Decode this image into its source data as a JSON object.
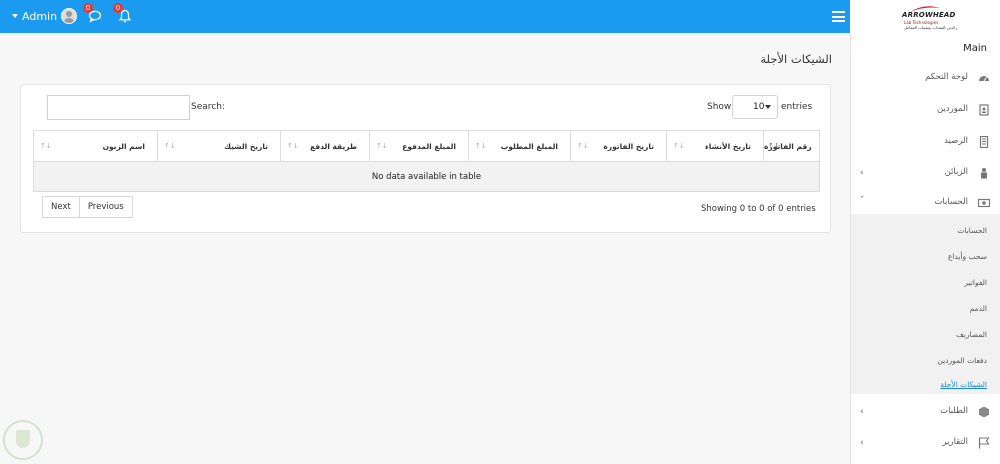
{
  "header": {
    "user_name": "Admin",
    "messages_count": "0",
    "notifications_count": "0",
    "logo_text": "ARROWHEAD",
    "logo_tagline": "Lab Technologies",
    "logo_tagline_ar": "رائدين المعدات وتقنيات المعامل"
  },
  "sidebar": {
    "main_label": "Main",
    "items": [
      {
        "label": "لوحة التحكم",
        "icon": "dashboard-icon"
      },
      {
        "label": "الموردين",
        "icon": "suppliers-icon"
      },
      {
        "label": "الرصيد",
        "icon": "balance-icon"
      },
      {
        "label": "الزبائن",
        "icon": "customers-icon"
      },
      {
        "label": "الحسابات",
        "icon": "accounts-icon"
      },
      {
        "label": "الطلبات",
        "icon": "orders-icon"
      },
      {
        "label": "التقارير",
        "icon": "reports-icon"
      }
    ],
    "submenu": [
      {
        "label": "الحسابات"
      },
      {
        "label": "سحب وأيداع"
      },
      {
        "label": "الفواتير"
      },
      {
        "label": "الذمم"
      },
      {
        "label": "المصاريف"
      },
      {
        "label": "دفعات الموردين"
      },
      {
        "label": "الشيكات الأجلة"
      }
    ]
  },
  "page": {
    "title": "الشيكات الأجلة"
  },
  "table_controls": {
    "show_label": "Show",
    "length_value": "10",
    "entries_label": "entries",
    "search_label": "Search:",
    "search_value": ""
  },
  "table": {
    "columns": [
      "رقم الفاتورة",
      "تاريخ الأنشاء",
      "تاريخ الفاتورة",
      "المبلغ المطلوب",
      "المبلغ المدفوع",
      "طريقة الدفع",
      "تاريخ الشيك",
      "اسم الزبون",
      ""
    ],
    "empty_message": "No data available in table"
  },
  "footer": {
    "info": "Showing 0 to 0 of 0 entries",
    "previous": "Previous",
    "next": "Next"
  },
  "colors": {
    "topbar": "#1a9bf0",
    "active_link": "#1a88d8",
    "badge": "#e53935"
  }
}
